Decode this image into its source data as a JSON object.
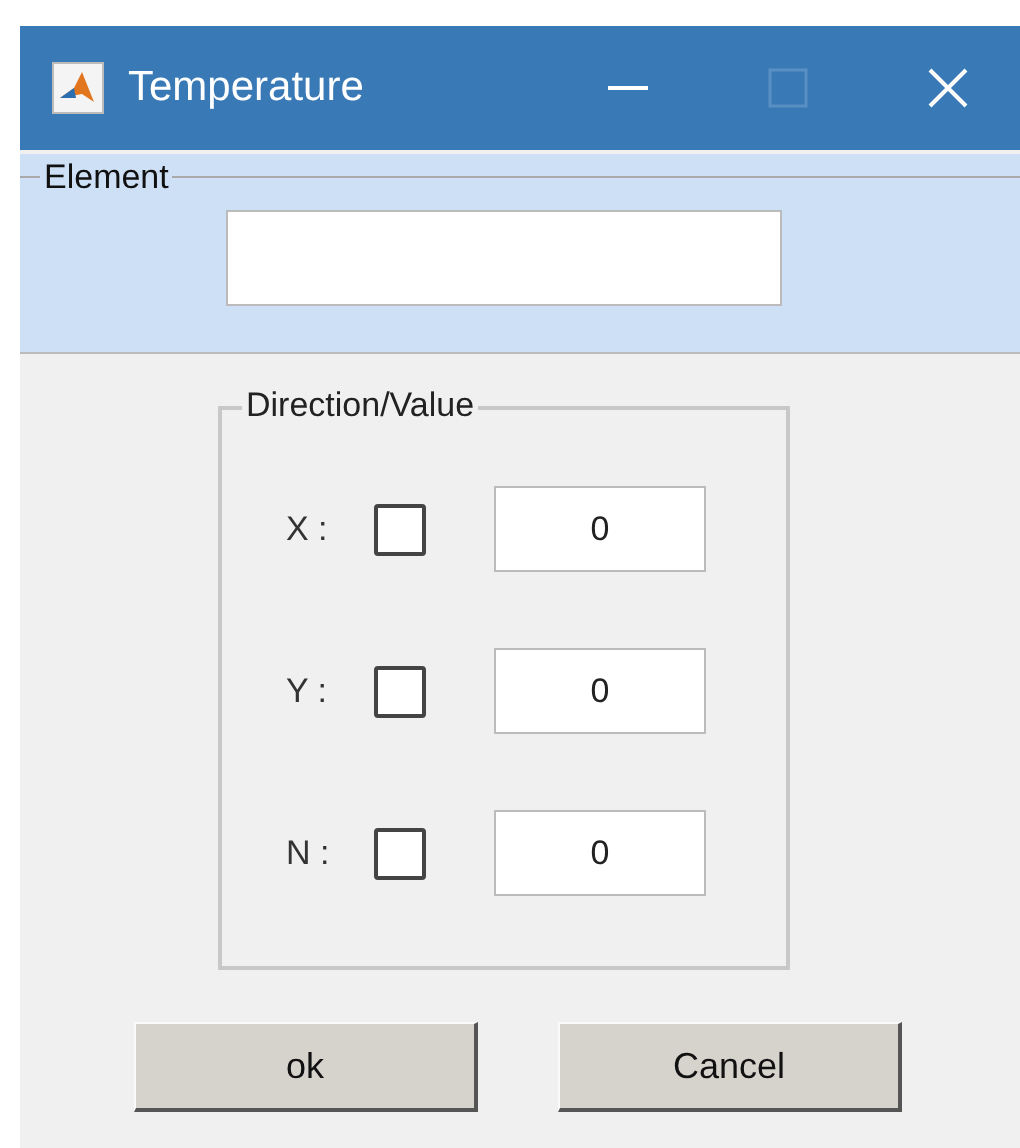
{
  "window": {
    "title": "Temperature",
    "maximize_enabled": false
  },
  "element_group": {
    "label": "Element"
  },
  "direction_group": {
    "label": "Direction/Value",
    "rows": [
      {
        "label": "X :",
        "checked": false,
        "value": "0"
      },
      {
        "label": "Y :",
        "checked": false,
        "value": "0"
      },
      {
        "label": "N :",
        "checked": false,
        "value": "0"
      }
    ]
  },
  "buttons": [
    "ok",
    "Cancel"
  ]
}
